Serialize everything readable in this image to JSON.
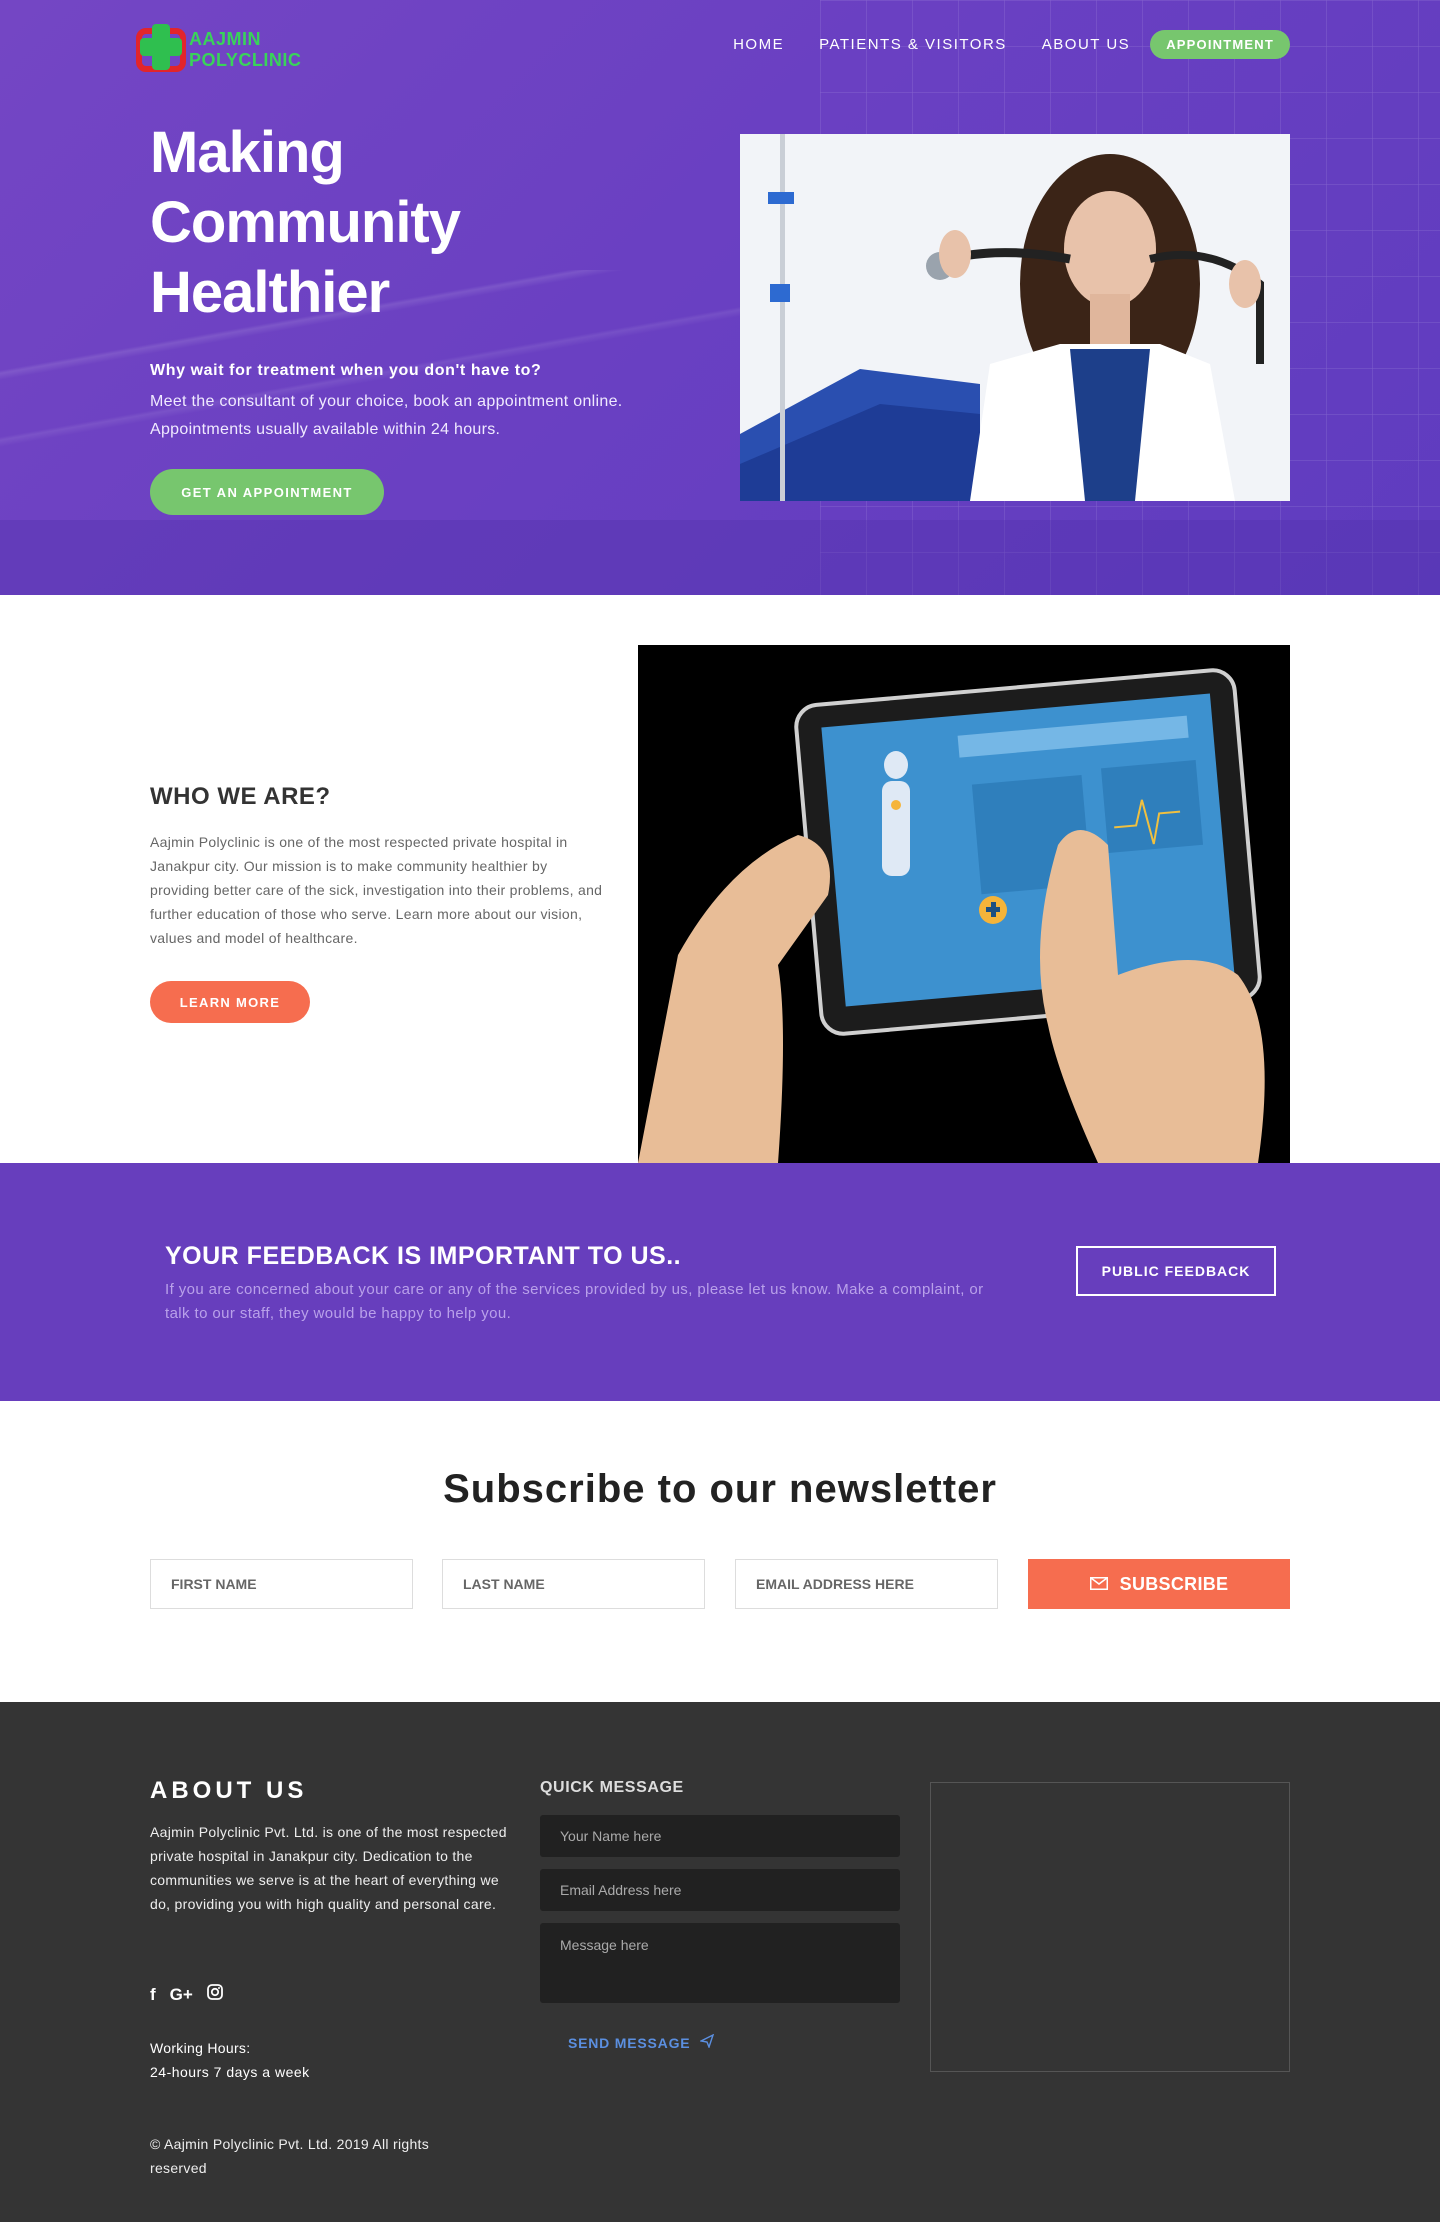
{
  "brand": {
    "name": "AAJMIN POLYCLINIC",
    "primary": "#673ebd",
    "accent_green": "#77c66e",
    "accent_orange": "#f66d4f"
  },
  "nav": {
    "items": [
      "HOME",
      "PATIENTS & VISITORS",
      "ABOUT US"
    ],
    "appointment": "APPOINTMENT"
  },
  "hero": {
    "title": "Making Community Healthier",
    "subtitle_bold": "Why wait for treatment when you don't have to?",
    "subtitle": "Meet the consultant of your choice, book an appointment online. Appointments usually available within 24 hours.",
    "cta": "GET AN APPOINTMENT"
  },
  "who": {
    "title": "WHO WE ARE?",
    "text": "Aajmin Polyclinic is one of the most respected private hospital in Janakpur city. Our mission is to make community healthier by providing better care of the sick, investigation into their problems, and further education of those who serve. Learn more about our vision, values and model of healthcare.",
    "cta": "LEARN MORE"
  },
  "feedback": {
    "title": "YOUR FEEDBACK IS IMPORTANT TO US..",
    "text": "If you are concerned about your care or any of the services provided by us, please let us know. Make a complaint, or talk to our staff, they would be happy to help you.",
    "button": "PUBLIC FEEDBACK"
  },
  "newsletter": {
    "title": "Subscribe to our newsletter",
    "first_name_placeholder": "FIRST NAME",
    "last_name_placeholder": "LAST NAME",
    "email_placeholder": "EMAIL ADDRESS HERE",
    "button": "SUBSCRIBE"
  },
  "footer": {
    "about_title": "ABOUT US",
    "about_text": "Aajmin Polyclinic Pvt. Ltd. is one of the most respected private hospital in Janakpur city. Dedication to the communities we serve is at the heart of everything we do, providing you with high quality and personal care.",
    "social": [
      "facebook-icon",
      "google-plus-icon",
      "instagram-icon"
    ],
    "hours_label": "Working Hours:",
    "hours": "24-hours 7 days a week",
    "copyright": "© Aajmin Polyclinic Pvt. Ltd. 2019 All rights reserved",
    "quick_message": {
      "title": "QUICK MESSAGE",
      "name_placeholder": "Your Name here",
      "email_placeholder": "Email Address here",
      "message_placeholder": "Message here",
      "send": "SEND MESSAGE"
    }
  }
}
